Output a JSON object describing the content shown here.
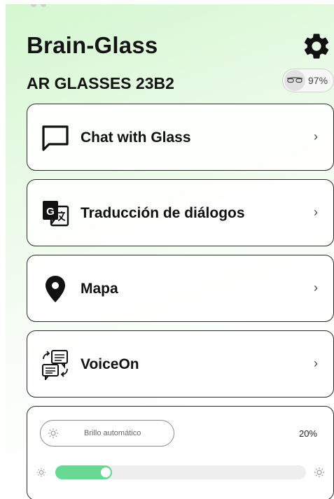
{
  "app": {
    "title": "Brain-Glass",
    "device_name": "AR GLASSES 23B2",
    "battery_percent": "97%"
  },
  "menu": [
    {
      "label": "Chat with Glass",
      "icon": "chat-bubble-icon",
      "chevron": "›"
    },
    {
      "label": "Traducción de diálogos",
      "icon": "translate-icon",
      "chevron": "›"
    },
    {
      "label": "Mapa",
      "icon": "map-pin-icon",
      "chevron": "›"
    },
    {
      "label": "VoiceOn",
      "icon": "voice-conversation-icon",
      "chevron": "›"
    }
  ],
  "brightness": {
    "auto_label": "Brillo automático",
    "value_text": "20%",
    "level": 0.2
  },
  "colors": {
    "accent": "#68d894",
    "background_tint": "#d3f7cf"
  }
}
